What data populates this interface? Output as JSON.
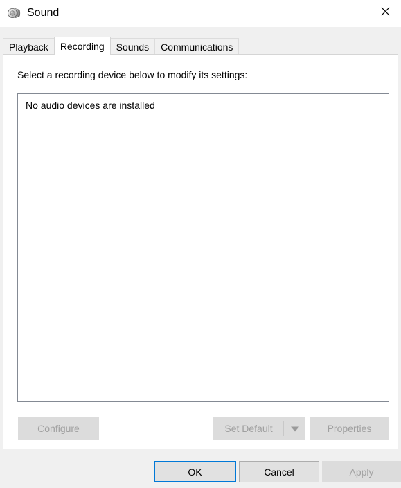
{
  "window": {
    "title": "Sound",
    "icon": "speaker-icon",
    "close_label": "✕",
    "accent_color": "#0078d7",
    "background_color": "#f0f0f0",
    "panel_color": "#ffffff"
  },
  "tabs": [
    {
      "label": "Playback",
      "active": false
    },
    {
      "label": "Recording",
      "active": true
    },
    {
      "label": "Sounds",
      "active": false
    },
    {
      "label": "Communications",
      "active": false
    }
  ],
  "panel": {
    "instruction": "Select a recording device below to modify its settings:",
    "device_list": {
      "empty_message": "No audio devices are installed",
      "items": []
    }
  },
  "action_buttons": {
    "configure": {
      "label": "Configure",
      "enabled": false
    },
    "set_default": {
      "label": "Set Default",
      "enabled": false
    },
    "set_default_arrow": {
      "label": "▼",
      "enabled": false
    },
    "properties": {
      "label": "Properties",
      "enabled": false
    }
  },
  "footer_buttons": {
    "ok": {
      "label": "OK",
      "enabled": true,
      "is_default": true
    },
    "cancel": {
      "label": "Cancel",
      "enabled": true,
      "is_default": false
    },
    "apply": {
      "label": "Apply",
      "enabled": false,
      "is_default": false
    }
  }
}
